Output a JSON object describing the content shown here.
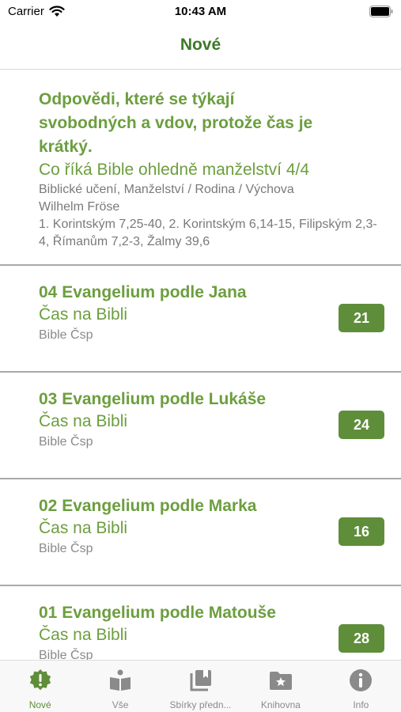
{
  "status_bar": {
    "carrier": "Carrier",
    "time": "10:43 AM"
  },
  "nav": {
    "title": "Nové"
  },
  "featured": {
    "title": "Odpovědi, které se týkají svobodných a vdov, protože čas je krátký.",
    "subtitle": "Co říká Bible ohledně manželství 4/4",
    "category": "Biblické učení, Manželství / Rodina / Výchova",
    "author": "Wilhelm Fröse",
    "references": "1. Korintským 7,25-40, 2. Korintským 6,14-15, Filipským 2,3-4, Římanům 7,2-3, Žalmy 39,6"
  },
  "items": [
    {
      "title": "04 Evangelium podle Jana",
      "subtitle": "Čas na Bibli",
      "source": "Bible Čsp",
      "badge": "21"
    },
    {
      "title": "03 Evangelium podle Lukáše",
      "subtitle": "Čas na Bibli",
      "source": "Bible Čsp",
      "badge": "24"
    },
    {
      "title": "02 Evangelium podle Marka",
      "subtitle": "Čas na Bibli",
      "source": "Bible Čsp",
      "badge": "16"
    },
    {
      "title": "01 Evangelium podle Matouše",
      "subtitle": "Čas na Bibli",
      "source": "Bible Čsp",
      "badge": "28"
    }
  ],
  "tabs": [
    {
      "label": "Nové",
      "icon": "new-badge-icon",
      "active": true
    },
    {
      "label": "Vše",
      "icon": "open-book-icon",
      "active": false
    },
    {
      "label": "Sbírky předn...",
      "icon": "collections-icon",
      "active": false
    },
    {
      "label": "Knihovna",
      "icon": "folder-star-icon",
      "active": false
    },
    {
      "label": "Info",
      "icon": "info-icon",
      "active": false
    }
  ],
  "colors": {
    "accent": "#3d7a28",
    "text_green": "#6c9e3f",
    "badge": "#5f8e3a",
    "inactive": "#8a8a8a"
  }
}
